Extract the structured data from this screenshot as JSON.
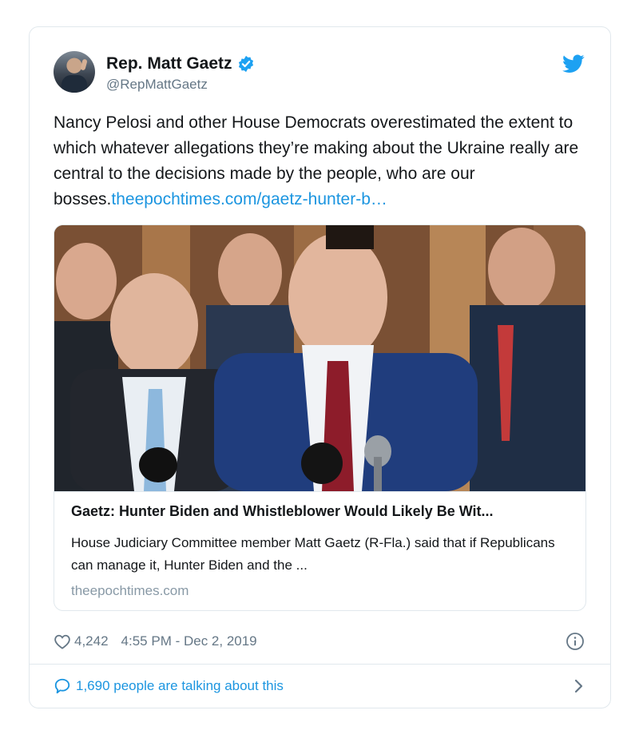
{
  "author": {
    "display_name": "Rep. Matt Gaetz",
    "handle": "@RepMattGaetz",
    "verified": true
  },
  "tweet": {
    "text": "Nancy Pelosi and other House Democrats overestimated the extent to which whatever allegations they’re making about the Ukraine really are central to the decisions made by the people, who are our bosses.",
    "link_text": "theepochtimes.com/gaetz-hunter-b…"
  },
  "card": {
    "title": "Gaetz: Hunter Biden and Whistleblower Would Likely Be Wit...",
    "description": "House Judiciary Committee member Matt Gaetz (R-Fla.) said that if Republicans can manage it, Hunter Biden and the ...",
    "domain": "theepochtimes.com"
  },
  "meta": {
    "likes": "4,242",
    "timestamp": "4:55 PM - Dec 2, 2019"
  },
  "footer": {
    "talking": "1,690 people are talking about this"
  },
  "colors": {
    "link": "#1b95e0",
    "muted": "#657786",
    "border": "#e1e8ed",
    "twitter_blue": "#1da1f2"
  },
  "icons": [
    "verified-badge-icon",
    "twitter-bird-icon",
    "heart-icon",
    "info-icon",
    "speech-bubble-icon",
    "chevron-right-icon"
  ]
}
